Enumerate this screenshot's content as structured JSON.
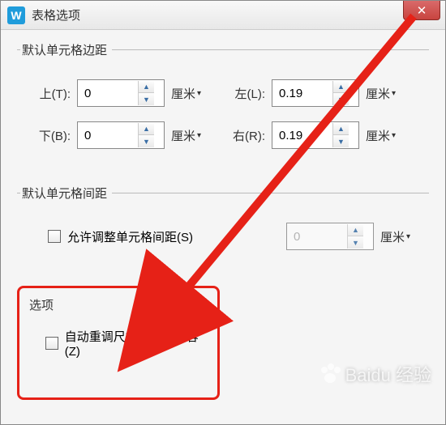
{
  "title": "表格选项",
  "app_icon_glyph": "W",
  "groups": {
    "margins": {
      "legend": "默认单元格边距",
      "top": {
        "label": "上(T):",
        "value": "0",
        "unit": "厘米"
      },
      "left": {
        "label": "左(L):",
        "value": "0.19",
        "unit": "厘米"
      },
      "bottom": {
        "label": "下(B):",
        "value": "0",
        "unit": "厘米"
      },
      "right": {
        "label": "右(R):",
        "value": "0.19",
        "unit": "厘米"
      }
    },
    "spacing": {
      "legend": "默认单元格间距",
      "check_label": "允许调整单元格间距(S)",
      "value": "0",
      "unit": "厘米"
    },
    "options": {
      "legend": "选项",
      "check_label": "自动重调尺寸以适应内容(Z)"
    }
  },
  "watermark": "Baidu 经验"
}
